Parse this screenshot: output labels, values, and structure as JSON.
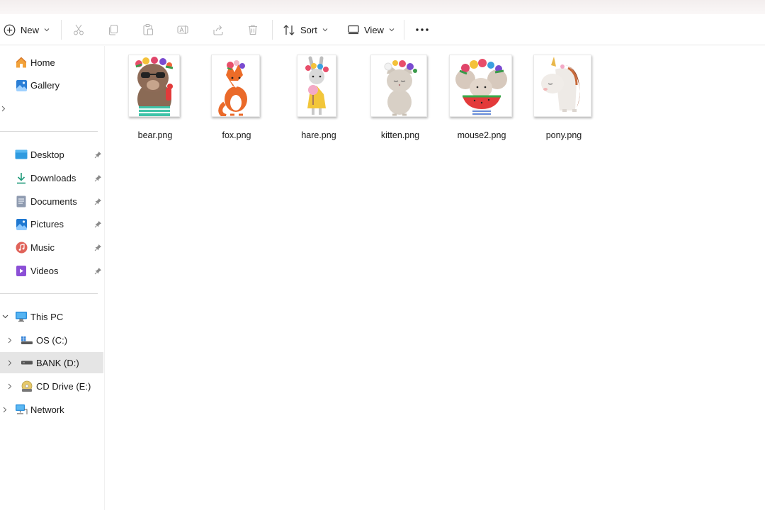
{
  "toolbar": {
    "new_label": "New",
    "sort_label": "Sort",
    "view_label": "View",
    "icons": [
      "cut-icon",
      "copy-icon",
      "paste-icon",
      "rename-icon",
      "share-icon",
      "delete-icon",
      "more-icon"
    ]
  },
  "sidebar": {
    "top": [
      {
        "label": "Home",
        "icon": "home-icon"
      },
      {
        "label": "Gallery",
        "icon": "gallery-icon"
      }
    ],
    "pinned": [
      {
        "label": "Desktop",
        "icon": "desktop-folder-icon"
      },
      {
        "label": "Downloads",
        "icon": "downloads-icon"
      },
      {
        "label": "Documents",
        "icon": "documents-icon"
      },
      {
        "label": "Pictures",
        "icon": "pictures-icon"
      },
      {
        "label": "Music",
        "icon": "music-icon"
      },
      {
        "label": "Videos",
        "icon": "videos-icon"
      }
    ],
    "this_pc": {
      "label": "This PC",
      "icon": "computer-icon"
    },
    "drives": [
      {
        "label": "OS (C:)",
        "icon": "os-drive-icon"
      },
      {
        "label": "BANK (D:)",
        "icon": "drive-icon",
        "selected": true
      },
      {
        "label": "CD Drive (E:)",
        "icon": "cd-drive-icon"
      }
    ],
    "network": {
      "label": "Network",
      "icon": "network-icon"
    }
  },
  "files": [
    {
      "name": "bear.png"
    },
    {
      "name": "fox.png"
    },
    {
      "name": "hare.png"
    },
    {
      "name": "kitten.png"
    },
    {
      "name": "mouse2.png"
    },
    {
      "name": "pony.png"
    }
  ],
  "colors": {
    "selected_bg": "#e5e5e5",
    "accent": "#0067c0"
  }
}
